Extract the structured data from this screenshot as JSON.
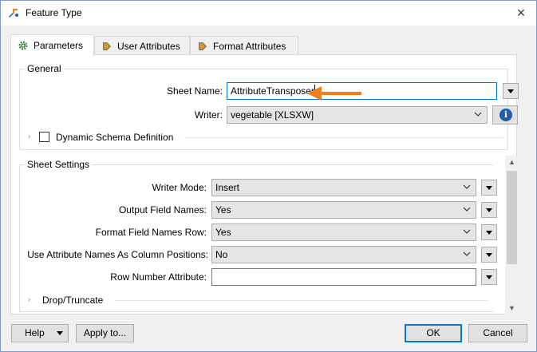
{
  "window": {
    "title": "Feature Type",
    "close_glyph": "×"
  },
  "tabs": [
    {
      "label": "Parameters",
      "icon": "gear-icon",
      "active": true
    },
    {
      "label": "User Attributes",
      "icon": "arrow-right-icon",
      "active": false
    },
    {
      "label": "Format Attributes",
      "icon": "arrow-right-icon",
      "active": false
    }
  ],
  "general": {
    "legend": "General",
    "sheet_name": {
      "label": "Sheet Name:",
      "value": "AttributeTransposer"
    },
    "writer": {
      "label": "Writer:",
      "value": "vegetable [XLSXW]"
    },
    "info_glyph": "i",
    "dynamic_schema": {
      "label": "Dynamic Schema Definition",
      "checked": false,
      "expander": "›"
    }
  },
  "sheet_settings": {
    "legend": "Sheet Settings",
    "writer_mode": {
      "label": "Writer Mode:",
      "value": "Insert"
    },
    "output_field_names": {
      "label": "Output Field Names:",
      "value": "Yes"
    },
    "format_field_names_row": {
      "label": "Format Field Names Row:",
      "value": "Yes"
    },
    "use_attr_names": {
      "label": "Use Attribute Names As Column Positions:",
      "value": "No"
    },
    "row_number_attr": {
      "label": "Row Number Attribute:",
      "value": ""
    },
    "drop_truncate": {
      "label": "Drop/Truncate",
      "expander": "›"
    }
  },
  "footer": {
    "help_label": "Help",
    "apply_label": "Apply to...",
    "ok_label": "OK",
    "cancel_label": "Cancel"
  },
  "colors": {
    "accent": "#0078d7",
    "annotation_arrow": "#f07d1e",
    "info": "#1f5fa8"
  }
}
